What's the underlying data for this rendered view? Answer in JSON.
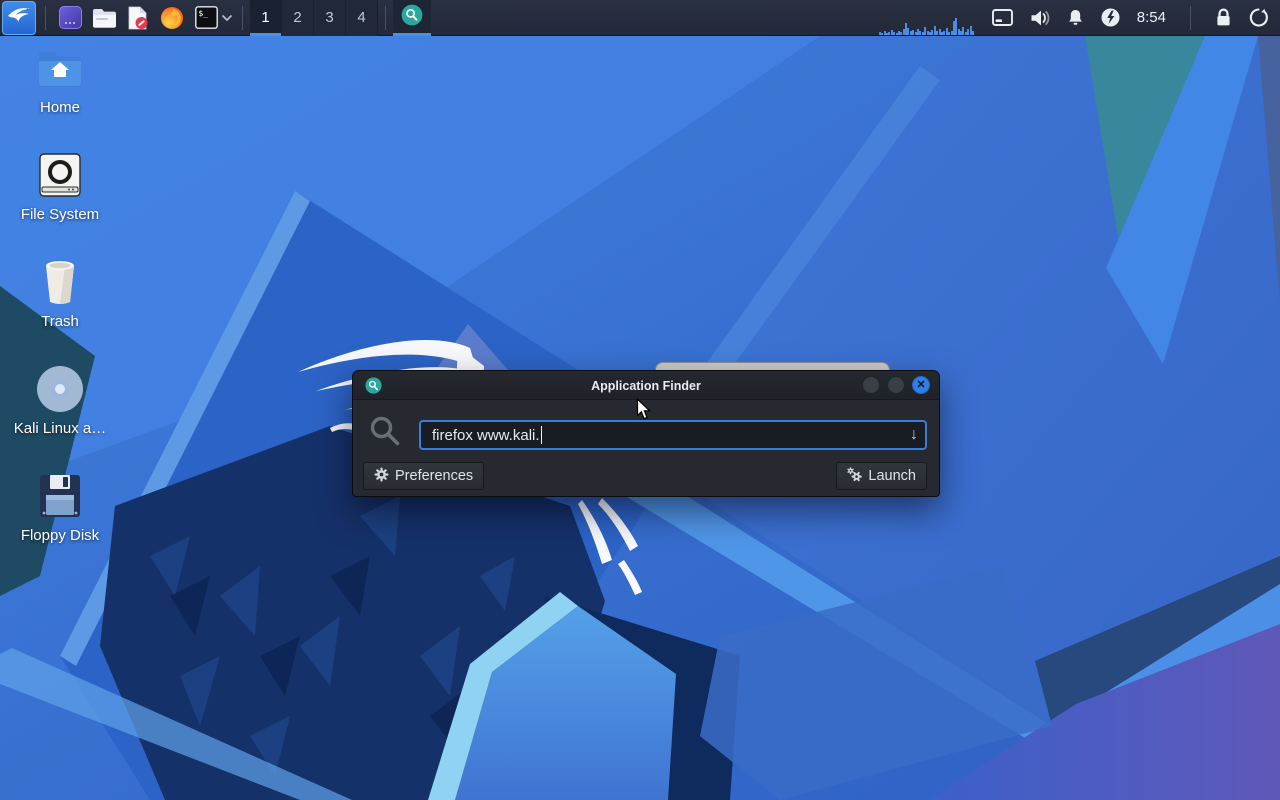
{
  "panel": {
    "workspaces": {
      "items": [
        "1",
        "2",
        "3",
        "4"
      ],
      "active_index": 0
    },
    "clock": "8:54",
    "cpu_graph": {
      "bars": [
        3,
        2,
        4,
        2,
        3,
        5,
        3,
        2,
        4,
        3,
        6,
        12,
        7,
        4,
        5,
        3,
        6,
        4,
        3,
        8,
        4,
        3,
        5,
        9,
        4,
        6,
        3,
        4,
        7,
        3,
        4,
        14,
        17,
        6,
        4,
        8,
        3,
        6,
        9,
        4
      ]
    },
    "launcher_names": [
      "applications-menu",
      "purple-app",
      "file-manager",
      "text-editor",
      "firefox",
      "terminal"
    ],
    "terminal_glyph": "$_"
  },
  "desktop_icons": [
    {
      "label": "Home"
    },
    {
      "label": "File System"
    },
    {
      "label": "Trash"
    },
    {
      "label": "Kali Linux a…"
    },
    {
      "label": "Floppy Disk"
    }
  ],
  "finder": {
    "title": "Application Finder",
    "query": "firefox www.kali.",
    "dropdown_glyph": "↓",
    "close_glyph": "✕",
    "preferences_label": "Preferences",
    "launch_label": "Launch"
  },
  "icons": {
    "titlebar": "search-icon (teal circle magnifier)",
    "field_left": "search-icon (large gray magnifier)",
    "preferences": "gear-icon",
    "launch": "run-gears-icon",
    "tray": [
      "display-icon",
      "volume-icon",
      "bell-icon",
      "power-icon",
      "lock-icon",
      "logout-icon"
    ]
  },
  "colors": {
    "accent_blue": "#3b7dd8",
    "underline_blue": "#4b8fe2",
    "teal_badge": "#2aa89d",
    "close_button": "#2e7fe8",
    "panel_bg": "#242a38",
    "dialog_bg": "#26292f"
  }
}
